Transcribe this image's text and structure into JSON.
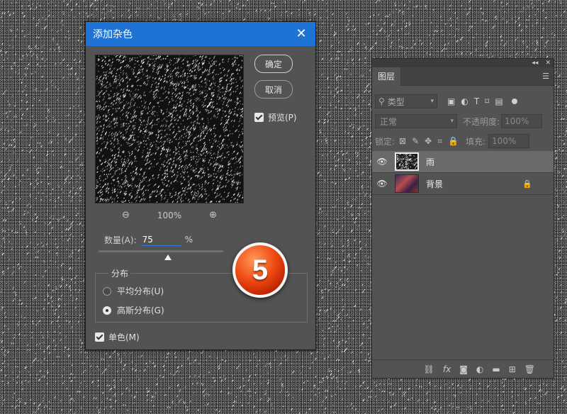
{
  "dialog": {
    "title": "添加杂色",
    "close_icon": "close-icon",
    "ok_label": "确定",
    "cancel_label": "取消",
    "preview_label": "预览(P)",
    "preview_checked": true,
    "zoom": "100%",
    "amount_label": "数量(A):",
    "amount_value": "75",
    "amount_unit": "%",
    "amount_level": 0.75,
    "distribution": {
      "legend": "分布",
      "options": [
        {
          "label": "平均分布(U)",
          "checked": false
        },
        {
          "label": "高斯分布(G)",
          "checked": true
        }
      ]
    },
    "monochromatic_label": "单色(M)",
    "monochromatic_checked": true
  },
  "badge": {
    "number": "5"
  },
  "layers_panel": {
    "tab_label": "图层",
    "filter_kind": "类型",
    "blend_mode": "正常",
    "opacity_label": "不透明度:",
    "opacity_value": "100%",
    "lock_label": "锁定:",
    "fill_label": "填充:",
    "fill_value": "100%",
    "layers": [
      {
        "name": "雨",
        "thumbnail": "noise",
        "visible": true,
        "selected": true,
        "locked": false
      },
      {
        "name": "背景",
        "thumbnail": "photo",
        "visible": true,
        "selected": false,
        "locked": true
      }
    ]
  },
  "colors": {
    "titlebar": "#1e73d4",
    "dialog_bg": "#535353",
    "badge": "#f04a12"
  }
}
